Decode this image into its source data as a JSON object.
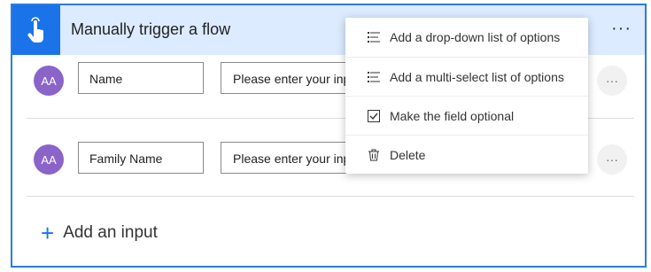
{
  "header": {
    "title": "Manually trigger a flow",
    "more": "···"
  },
  "rows": [
    {
      "avatar": "AA",
      "name": "Name",
      "value": "Please enter your input",
      "more": "···"
    },
    {
      "avatar": "AA",
      "name": "Family Name",
      "value": "Please enter your input",
      "more": "···"
    }
  ],
  "add_input": {
    "label": "Add an input"
  },
  "menu": {
    "items": [
      {
        "label": "Add a drop-down list of options",
        "icon": "list-icon"
      },
      {
        "label": "Add a multi-select list of options",
        "icon": "list-icon"
      },
      {
        "label": "Make the field optional",
        "icon": "checkbox-icon"
      },
      {
        "label": "Delete",
        "icon": "trash-icon"
      }
    ]
  },
  "colors": {
    "accent": "#1a73e8",
    "header_bg": "#dcebff",
    "avatar": "#8b64c9",
    "border": "#2b7be4"
  }
}
